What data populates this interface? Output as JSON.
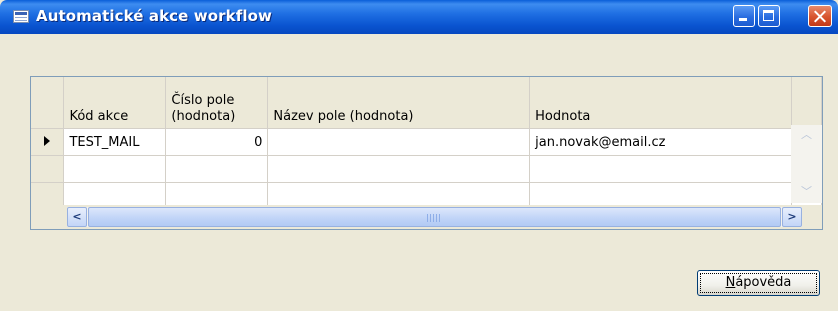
{
  "window": {
    "title": "Automatické akce workflow",
    "icon": "table-icon",
    "controls": [
      "minimize-icon",
      "maximize-icon",
      "close-icon"
    ]
  },
  "grid": {
    "columns": [
      {
        "label": ""
      },
      {
        "label": "Kód akce"
      },
      {
        "label": "Číslo pole (hodnota)"
      },
      {
        "label": "Název pole (hodnota)"
      },
      {
        "label": "Hodnota"
      }
    ],
    "rows": [
      {
        "current": true,
        "kod_akce": "TEST_MAIL",
        "cislo_pole": "0",
        "nazev_pole": "",
        "hodnota": "jan.novak@email.cz"
      },
      {
        "current": false,
        "kod_akce": "",
        "cislo_pole": "",
        "nazev_pole": "",
        "hodnota": ""
      },
      {
        "current": false,
        "kod_akce": "",
        "cislo_pole": "",
        "nazev_pole": "",
        "hodnota": ""
      }
    ]
  },
  "buttons": {
    "help_label": "Nápověda",
    "help_label_first": "N",
    "help_label_rest": "ápověda"
  },
  "colors": {
    "titlebar": "#0a54d0",
    "window_bg": "#ece9d8",
    "grid_border": "#7f9db9"
  }
}
